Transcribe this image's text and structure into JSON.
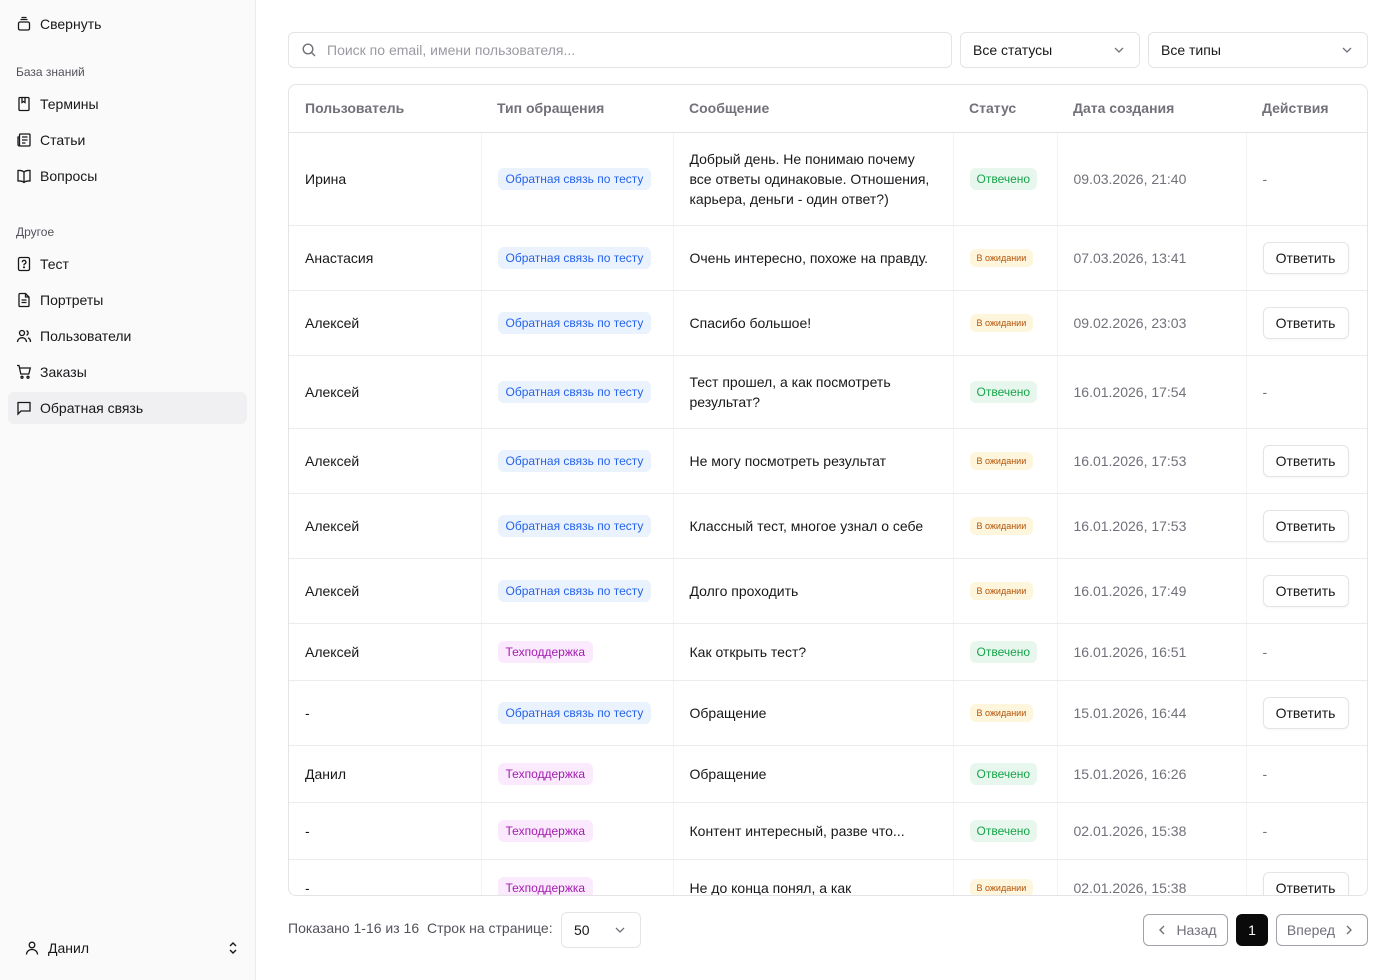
{
  "sidebar": {
    "collapse_label": "Свернуть",
    "groups": [
      {
        "label": "База знаний",
        "items": [
          {
            "label": "Термины",
            "icon": "bookmark-book-icon"
          },
          {
            "label": "Статьи",
            "icon": "newspaper-icon"
          },
          {
            "label": "Вопросы",
            "icon": "open-book-icon"
          }
        ]
      },
      {
        "label": "Другое",
        "items": [
          {
            "label": "Тест",
            "icon": "question-file-icon"
          },
          {
            "label": "Портреты",
            "icon": "document-icon"
          },
          {
            "label": "Пользователи",
            "icon": "users-icon"
          },
          {
            "label": "Заказы",
            "icon": "cart-icon"
          },
          {
            "label": "Обратная связь",
            "icon": "message-square-icon",
            "active": true
          }
        ]
      }
    ],
    "user": {
      "name": "Данил",
      "icon": "user-icon"
    }
  },
  "filters": {
    "search_placeholder": "Поиск по email, имени пользователя...",
    "status_value": "Все статусы",
    "type_value": "Все типы"
  },
  "table": {
    "columns": [
      "Пользователь",
      "Тип обращения",
      "Сообщение",
      "Статус",
      "Дата создания",
      "Действия"
    ],
    "rows": [
      {
        "user": "Ирина",
        "type": "Обратная связь по тесту",
        "type_kind": "feedback",
        "message": "Добрый день. Не понимаю почему все ответы одинаковые. Отношения, карьера, деньги - один ответ?)",
        "status": "Отвечено",
        "status_kind": "answered",
        "date": "09.03.2026, 21:40",
        "action": "-"
      },
      {
        "user": "Анастасия",
        "type": "Обратная связь по тесту",
        "type_kind": "feedback",
        "message": "Очень интересно, похоже на правду.",
        "status": "В ожидании",
        "status_kind": "waiting",
        "date": "07.03.2026, 13:41",
        "action": "Ответить"
      },
      {
        "user": "Алексей",
        "type": "Обратная связь по тесту",
        "type_kind": "feedback",
        "message": "Спасибо большое!",
        "status": "В ожидании",
        "status_kind": "waiting",
        "date": "09.02.2026, 23:03",
        "action": "Ответить"
      },
      {
        "user": "Алексей",
        "type": "Обратная связь по тесту",
        "type_kind": "feedback",
        "message": "Тест прошел, а как посмотреть результат?",
        "status": "Отвечено",
        "status_kind": "answered",
        "date": "16.01.2026, 17:54",
        "action": "-"
      },
      {
        "user": "Алексей",
        "type": "Обратная связь по тесту",
        "type_kind": "feedback",
        "message": "Не могу посмотреть результат",
        "status": "В ожидании",
        "status_kind": "waiting",
        "date": "16.01.2026, 17:53",
        "action": "Ответить"
      },
      {
        "user": "Алексей",
        "type": "Обратная связь по тесту",
        "type_kind": "feedback",
        "message": "Классный тест, многое узнал о себе",
        "status": "В ожидании",
        "status_kind": "waiting",
        "date": "16.01.2026, 17:53",
        "action": "Ответить"
      },
      {
        "user": "Алексей",
        "type": "Обратная связь по тесту",
        "type_kind": "feedback",
        "message": "Долго проходить",
        "status": "В ожидании",
        "status_kind": "waiting",
        "date": "16.01.2026, 17:49",
        "action": "Ответить"
      },
      {
        "user": "Алексей",
        "type": "Техподдержка",
        "type_kind": "support",
        "message": "Как открыть тест?",
        "status": "Отвечено",
        "status_kind": "answered",
        "date": "16.01.2026, 16:51",
        "action": "-"
      },
      {
        "user": "-",
        "type": "Обратная связь по тесту",
        "type_kind": "feedback",
        "message": "Обращение",
        "status": "В ожидании",
        "status_kind": "waiting",
        "date": "15.01.2026, 16:44",
        "action": "Ответить"
      },
      {
        "user": "Данил",
        "type": "Техподдержка",
        "type_kind": "support",
        "message": "Обращение",
        "status": "Отвечено",
        "status_kind": "answered",
        "date": "15.01.2026, 16:26",
        "action": "-"
      },
      {
        "user": "-",
        "type": "Техподдержка",
        "type_kind": "support",
        "message": "Контент интересный, разве что...",
        "status": "Отвечено",
        "status_kind": "answered",
        "date": "02.01.2026, 15:38",
        "action": "-"
      },
      {
        "user": "-",
        "type": "Техподдержка",
        "type_kind": "support",
        "message": "Не до конца понял, а как",
        "status": "В ожидании",
        "status_kind": "waiting",
        "date": "02.01.2026, 15:38",
        "action": "Ответить"
      }
    ]
  },
  "pagination": {
    "shown_text": "Показано 1-16 из 16",
    "rows_label": "Строк на странице:",
    "rows_value": "50",
    "prev_label": "Назад",
    "current_page": "1",
    "next_label": "Вперед"
  },
  "colors": {
    "feedback_tag_bg": "#eaf2fe",
    "feedback_tag_text": "#2563eb",
    "support_tag_bg": "#fbeafe",
    "support_tag_text": "#a21caf",
    "answered_bg": "#e8f7ed",
    "answered_text": "#16a34a",
    "waiting_bg": "#fdf6dc",
    "waiting_text": "#b45309",
    "current_page_bg": "#0a0a0a"
  }
}
